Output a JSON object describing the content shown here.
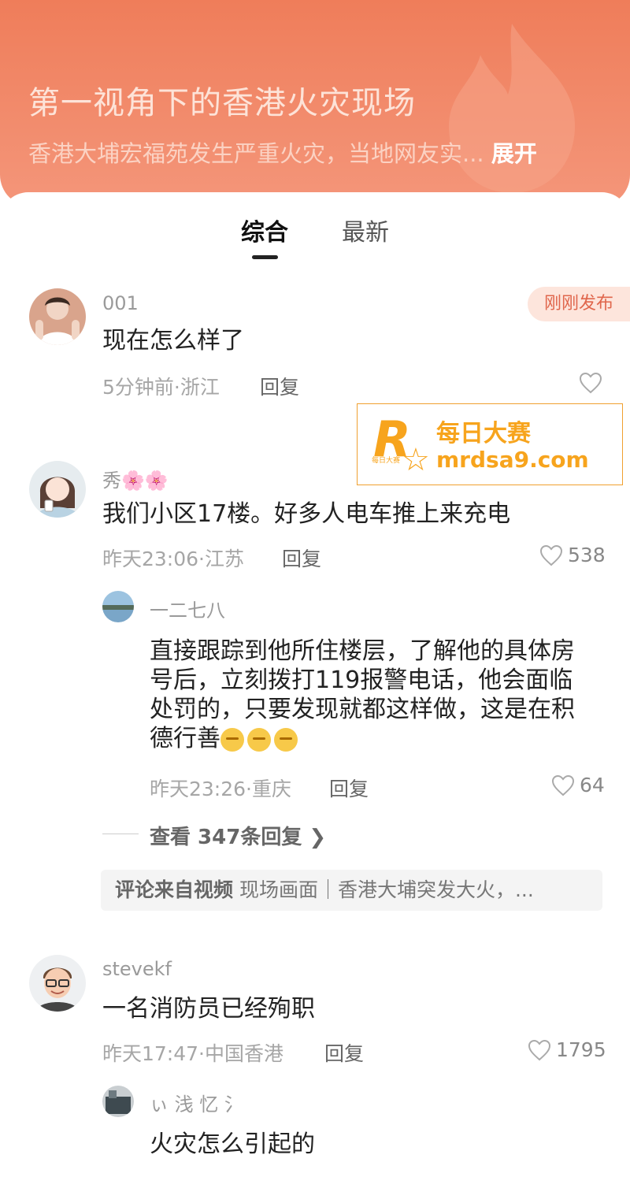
{
  "header": {
    "title": "第一视角下的香港火灾现场",
    "description": "香港大埔宏福苑发生严重火灾，当地网友实...",
    "expand_label": "展开"
  },
  "tabs": [
    {
      "label": "综合",
      "active": true
    },
    {
      "label": "最新",
      "active": false
    }
  ],
  "badge": "刚刚发布",
  "watermark": {
    "logo_letter": "R",
    "logo_small": "每日大赛",
    "name": "每日大赛",
    "url": "mrdsa9.com"
  },
  "comments": [
    {
      "user": "001",
      "text": "现在怎么样了",
      "meta": "5分钟前·浙江",
      "reply_label": "回复",
      "likes": ""
    },
    {
      "user": "秀🌸🌸",
      "text": "我们小区17楼。好多人电车推上来充电",
      "meta": "昨天23:06·江苏",
      "reply_label": "回复",
      "likes": "538",
      "sub_reply": {
        "user": "一二七八",
        "text": "直接跟踪到他所住楼层，了解他的具体房号后，立刻拨打119报警电话，他会面临处罚的，只要发现就都这样做，这是在积德行善",
        "line1": "直接跟踪到他所住楼层，了解他的具体房",
        "line2": "号后，立刻拨打119报警电话，他会面临",
        "line3": "处罚的，只要发现就都这样做，这是在积",
        "line4": "德行善",
        "meta": "昨天23:26·重庆",
        "reply_label": "回复",
        "likes": "64"
      },
      "more_replies": "查看 347条回复 ❯",
      "source_label": "评论来自视频",
      "source_text": "现场画面｜香港大埔突发大火，..."
    },
    {
      "user": "stevekf",
      "text": "一名消防员已经殉职",
      "meta": "昨天17:47·中国香港",
      "reply_label": "回复",
      "likes": "1795",
      "sub_reply": {
        "user": "ぃ 浅 忆 氵",
        "text": "火灾怎么引起的"
      }
    }
  ],
  "colors": {
    "header_bg": "#ef7d5a",
    "badge_text": "#e0664c",
    "watermark": "#f7a41d"
  }
}
